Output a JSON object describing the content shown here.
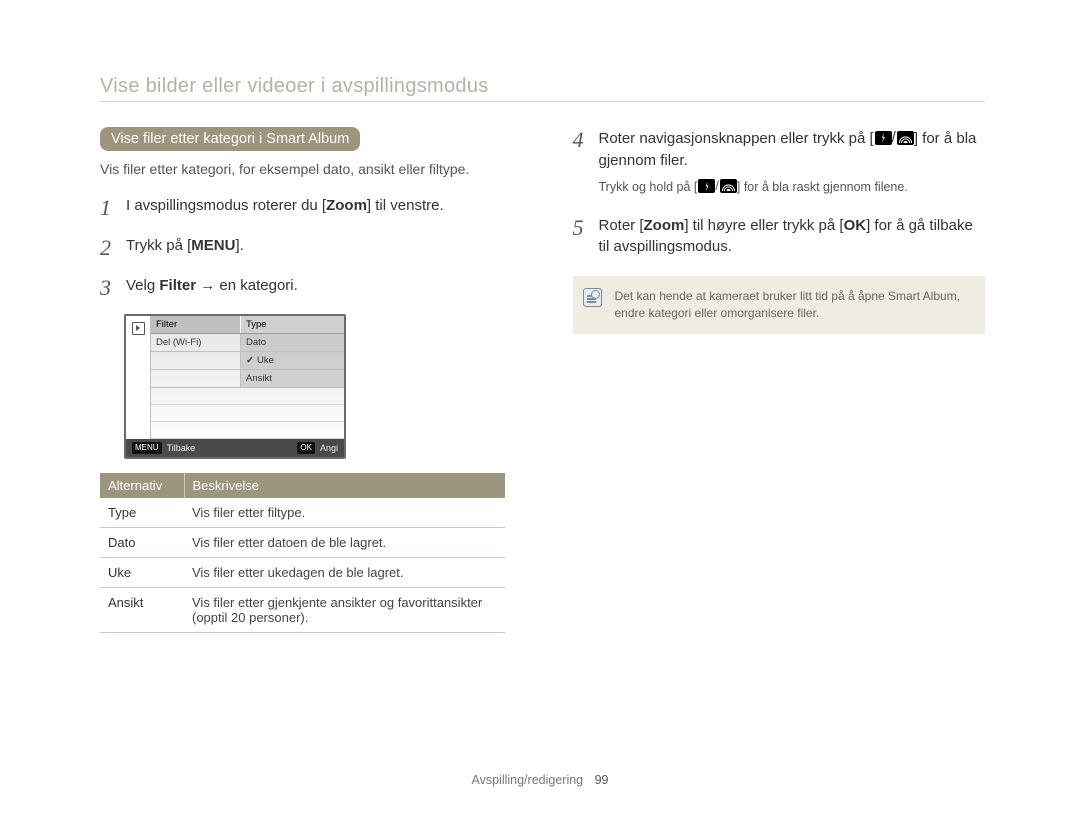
{
  "page_title": "Vise bilder eller videoer i avspillingsmodus",
  "section_pill": "Vise filer etter kategori i Smart Album",
  "section_sub": "Vis filer etter kategori, for eksempel dato, ansikt eller filtype.",
  "steps_left": {
    "s1": {
      "num": "1",
      "a": "I avspillingsmodus roterer du [",
      "b": "Zoom",
      "c": "] til venstre."
    },
    "s2": {
      "num": "2",
      "a": "Trykk på [",
      "m": "MENU",
      "c": "]."
    },
    "s3": {
      "num": "3",
      "a": "Velg ",
      "b": "Filter",
      "c": " → en kategori."
    }
  },
  "screen": {
    "hdr_left": "Filter",
    "hdr_right": "Type",
    "r1_left": "Del (Wi-Fi)",
    "r1_right": "Dato",
    "r2_right": "Uke",
    "r3_right": "Ansikt",
    "back_key": "MENU",
    "back": "Tilbake",
    "ok_key": "OK",
    "ok": "Angi"
  },
  "table": {
    "h1": "Alternativ",
    "h2": "Beskrivelse",
    "rows": [
      {
        "k": "Type",
        "v": "Vis filer etter filtype."
      },
      {
        "k": "Dato",
        "v": "Vis filer etter datoen de ble lagret."
      },
      {
        "k": "Uke",
        "v": "Vis filer etter ukedagen de ble lagret."
      },
      {
        "k": "Ansikt",
        "v": "Vis filer etter gjenkjente ansikter og favorittansikter (opptil 20 personer)."
      }
    ]
  },
  "steps_right": {
    "s4": {
      "num": "4",
      "a": "Roter navigasjonsknappen eller trykk på [",
      "c": "] for å bla gjennom filer.",
      "sub_a": "Trykk og hold på [",
      "sub_c": "] for å bla raskt gjennom filene."
    },
    "s5": {
      "num": "5",
      "a": "Roter [",
      "b": "Zoom",
      "c": "] til høyre eller trykk på [",
      "ok": "OK",
      "d": "] for å gå tilbake til avspillingsmodus."
    }
  },
  "note": "Det kan hende at kameraet bruker litt tid på å åpne Smart Album, endre kategori eller omorganisere filer.",
  "footer_section": "Avspilling/redigering",
  "footer_page": "99"
}
